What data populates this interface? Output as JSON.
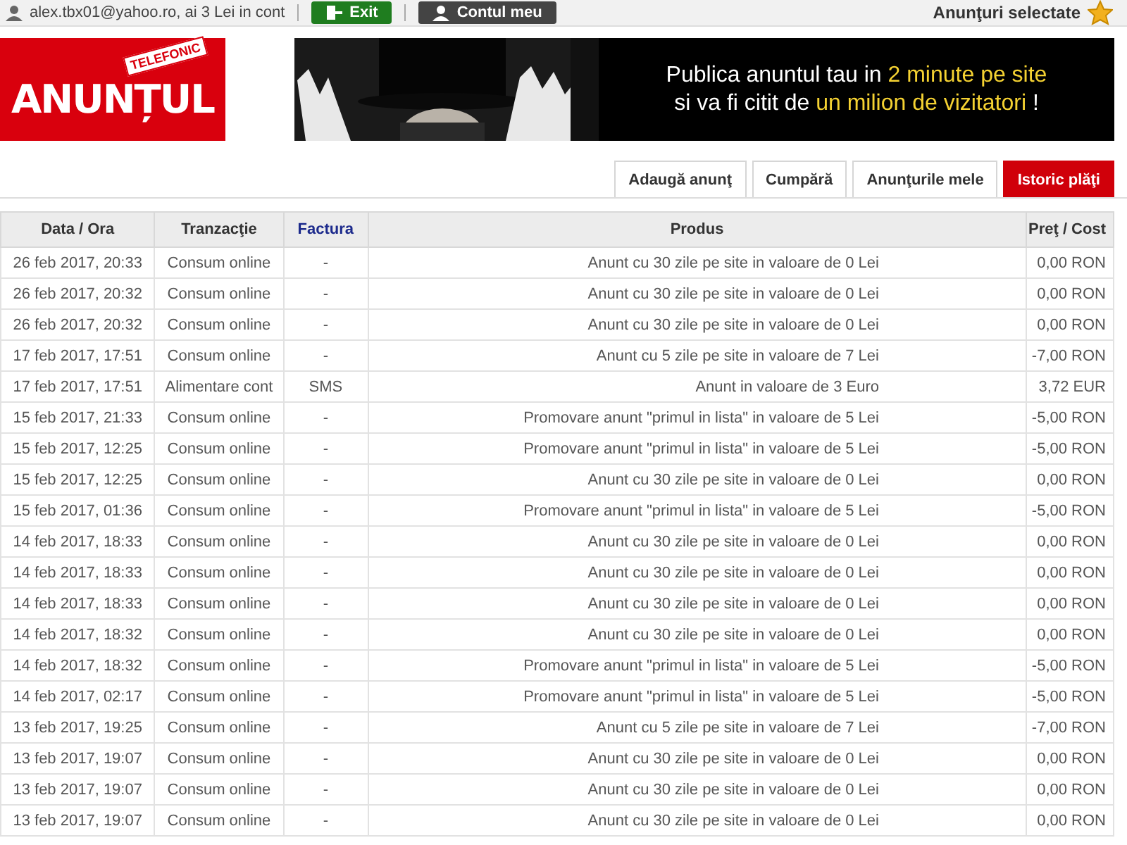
{
  "top_bar": {
    "account_text": "alex.tbx01@yahoo.ro, ai 3 Lei in cont",
    "buttons": [
      {
        "label": "Exit",
        "kind": "exit"
      },
      {
        "label": "Contul meu",
        "kind": "account"
      }
    ],
    "favorites": "Anunţuri selectate"
  },
  "logo": {
    "word": "ANUNȚUL",
    "ribbon": "TELEFONIC"
  },
  "banner": {
    "lines": [
      [
        {
          "text": "Publica anuntul tau in ",
          "highlight": false
        },
        {
          "text": "2 minute pe site",
          "highlight": true
        }
      ],
      [
        {
          "text": "si va fi citit de ",
          "highlight": false
        },
        {
          "text": "un milion de vizitatori",
          "highlight": true
        },
        {
          "text": " !",
          "highlight": false
        }
      ]
    ]
  },
  "tabs": [
    {
      "label": "Adaugă anunţ",
      "selected": false
    },
    {
      "label": "Cumpără",
      "selected": false
    },
    {
      "label": "Anunţurile mele",
      "selected": false
    },
    {
      "label": "Istoric plăţi",
      "selected": true
    }
  ],
  "table": {
    "columns": [
      {
        "label": "Data / Ora",
        "link": false
      },
      {
        "label": "Tranzacţie",
        "link": false
      },
      {
        "label": "Factura",
        "link": true
      },
      {
        "label": "Produs",
        "link": false
      },
      {
        "label": "Preţ / Cost",
        "link": false
      }
    ],
    "rows": [
      [
        "26 feb 2017, 20:33",
        "Consum online",
        "-",
        "Anunt cu 30 zile pe site in valoare de 0 Lei",
        "0,00 RON"
      ],
      [
        "26 feb 2017, 20:32",
        "Consum online",
        "-",
        "Anunt cu 30 zile pe site in valoare de 0 Lei",
        "0,00 RON"
      ],
      [
        "26 feb 2017, 20:32",
        "Consum online",
        "-",
        "Anunt cu 30 zile pe site in valoare de 0 Lei",
        "0,00 RON"
      ],
      [
        "17 feb 2017, 17:51",
        "Consum online",
        "-",
        "Anunt cu 5 zile pe site in valoare de 7 Lei",
        "-7,00 RON"
      ],
      [
        "17 feb 2017, 17:51",
        "Alimentare cont",
        "SMS",
        "Anunt in valoare de 3 Euro",
        "3,72 EUR"
      ],
      [
        "15 feb 2017, 21:33",
        "Consum online",
        "-",
        "Promovare anunt \"primul in lista\" in valoare de 5 Lei",
        "-5,00 RON"
      ],
      [
        "15 feb 2017, 12:25",
        "Consum online",
        "-",
        "Promovare anunt \"primul in lista\" in valoare de 5 Lei",
        "-5,00 RON"
      ],
      [
        "15 feb 2017, 12:25",
        "Consum online",
        "-",
        "Anunt cu 30 zile pe site in valoare de 0 Lei",
        "0,00 RON"
      ],
      [
        "15 feb 2017, 01:36",
        "Consum online",
        "-",
        "Promovare anunt \"primul in lista\" in valoare de 5 Lei",
        "-5,00 RON"
      ],
      [
        "14 feb 2017, 18:33",
        "Consum online",
        "-",
        "Anunt cu 30 zile pe site in valoare de 0 Lei",
        "0,00 RON"
      ],
      [
        "14 feb 2017, 18:33",
        "Consum online",
        "-",
        "Anunt cu 30 zile pe site in valoare de 0 Lei",
        "0,00 RON"
      ],
      [
        "14 feb 2017, 18:33",
        "Consum online",
        "-",
        "Anunt cu 30 zile pe site in valoare de 0 Lei",
        "0,00 RON"
      ],
      [
        "14 feb 2017, 18:32",
        "Consum online",
        "-",
        "Anunt cu 30 zile pe site in valoare de 0 Lei",
        "0,00 RON"
      ],
      [
        "14 feb 2017, 18:32",
        "Consum online",
        "-",
        "Promovare anunt \"primul in lista\" in valoare de 5 Lei",
        "-5,00 RON"
      ],
      [
        "14 feb 2017, 02:17",
        "Consum online",
        "-",
        "Promovare anunt \"primul in lista\" in valoare de 5 Lei",
        "-5,00 RON"
      ],
      [
        "13 feb 2017, 19:25",
        "Consum online",
        "-",
        "Anunt cu 5 zile pe site in valoare de 7 Lei",
        "-7,00 RON"
      ],
      [
        "13 feb 2017, 19:07",
        "Consum online",
        "-",
        "Anunt cu 30 zile pe site in valoare de 0 Lei",
        "0,00 RON"
      ],
      [
        "13 feb 2017, 19:07",
        "Consum online",
        "-",
        "Anunt cu 30 zile pe site in valoare de 0 Lei",
        "0,00 RON"
      ],
      [
        "13 feb 2017, 19:07",
        "Consum online",
        "-",
        "Anunt cu 30 zile pe site in valoare de 0 Lei",
        "0,00 RON"
      ]
    ]
  }
}
